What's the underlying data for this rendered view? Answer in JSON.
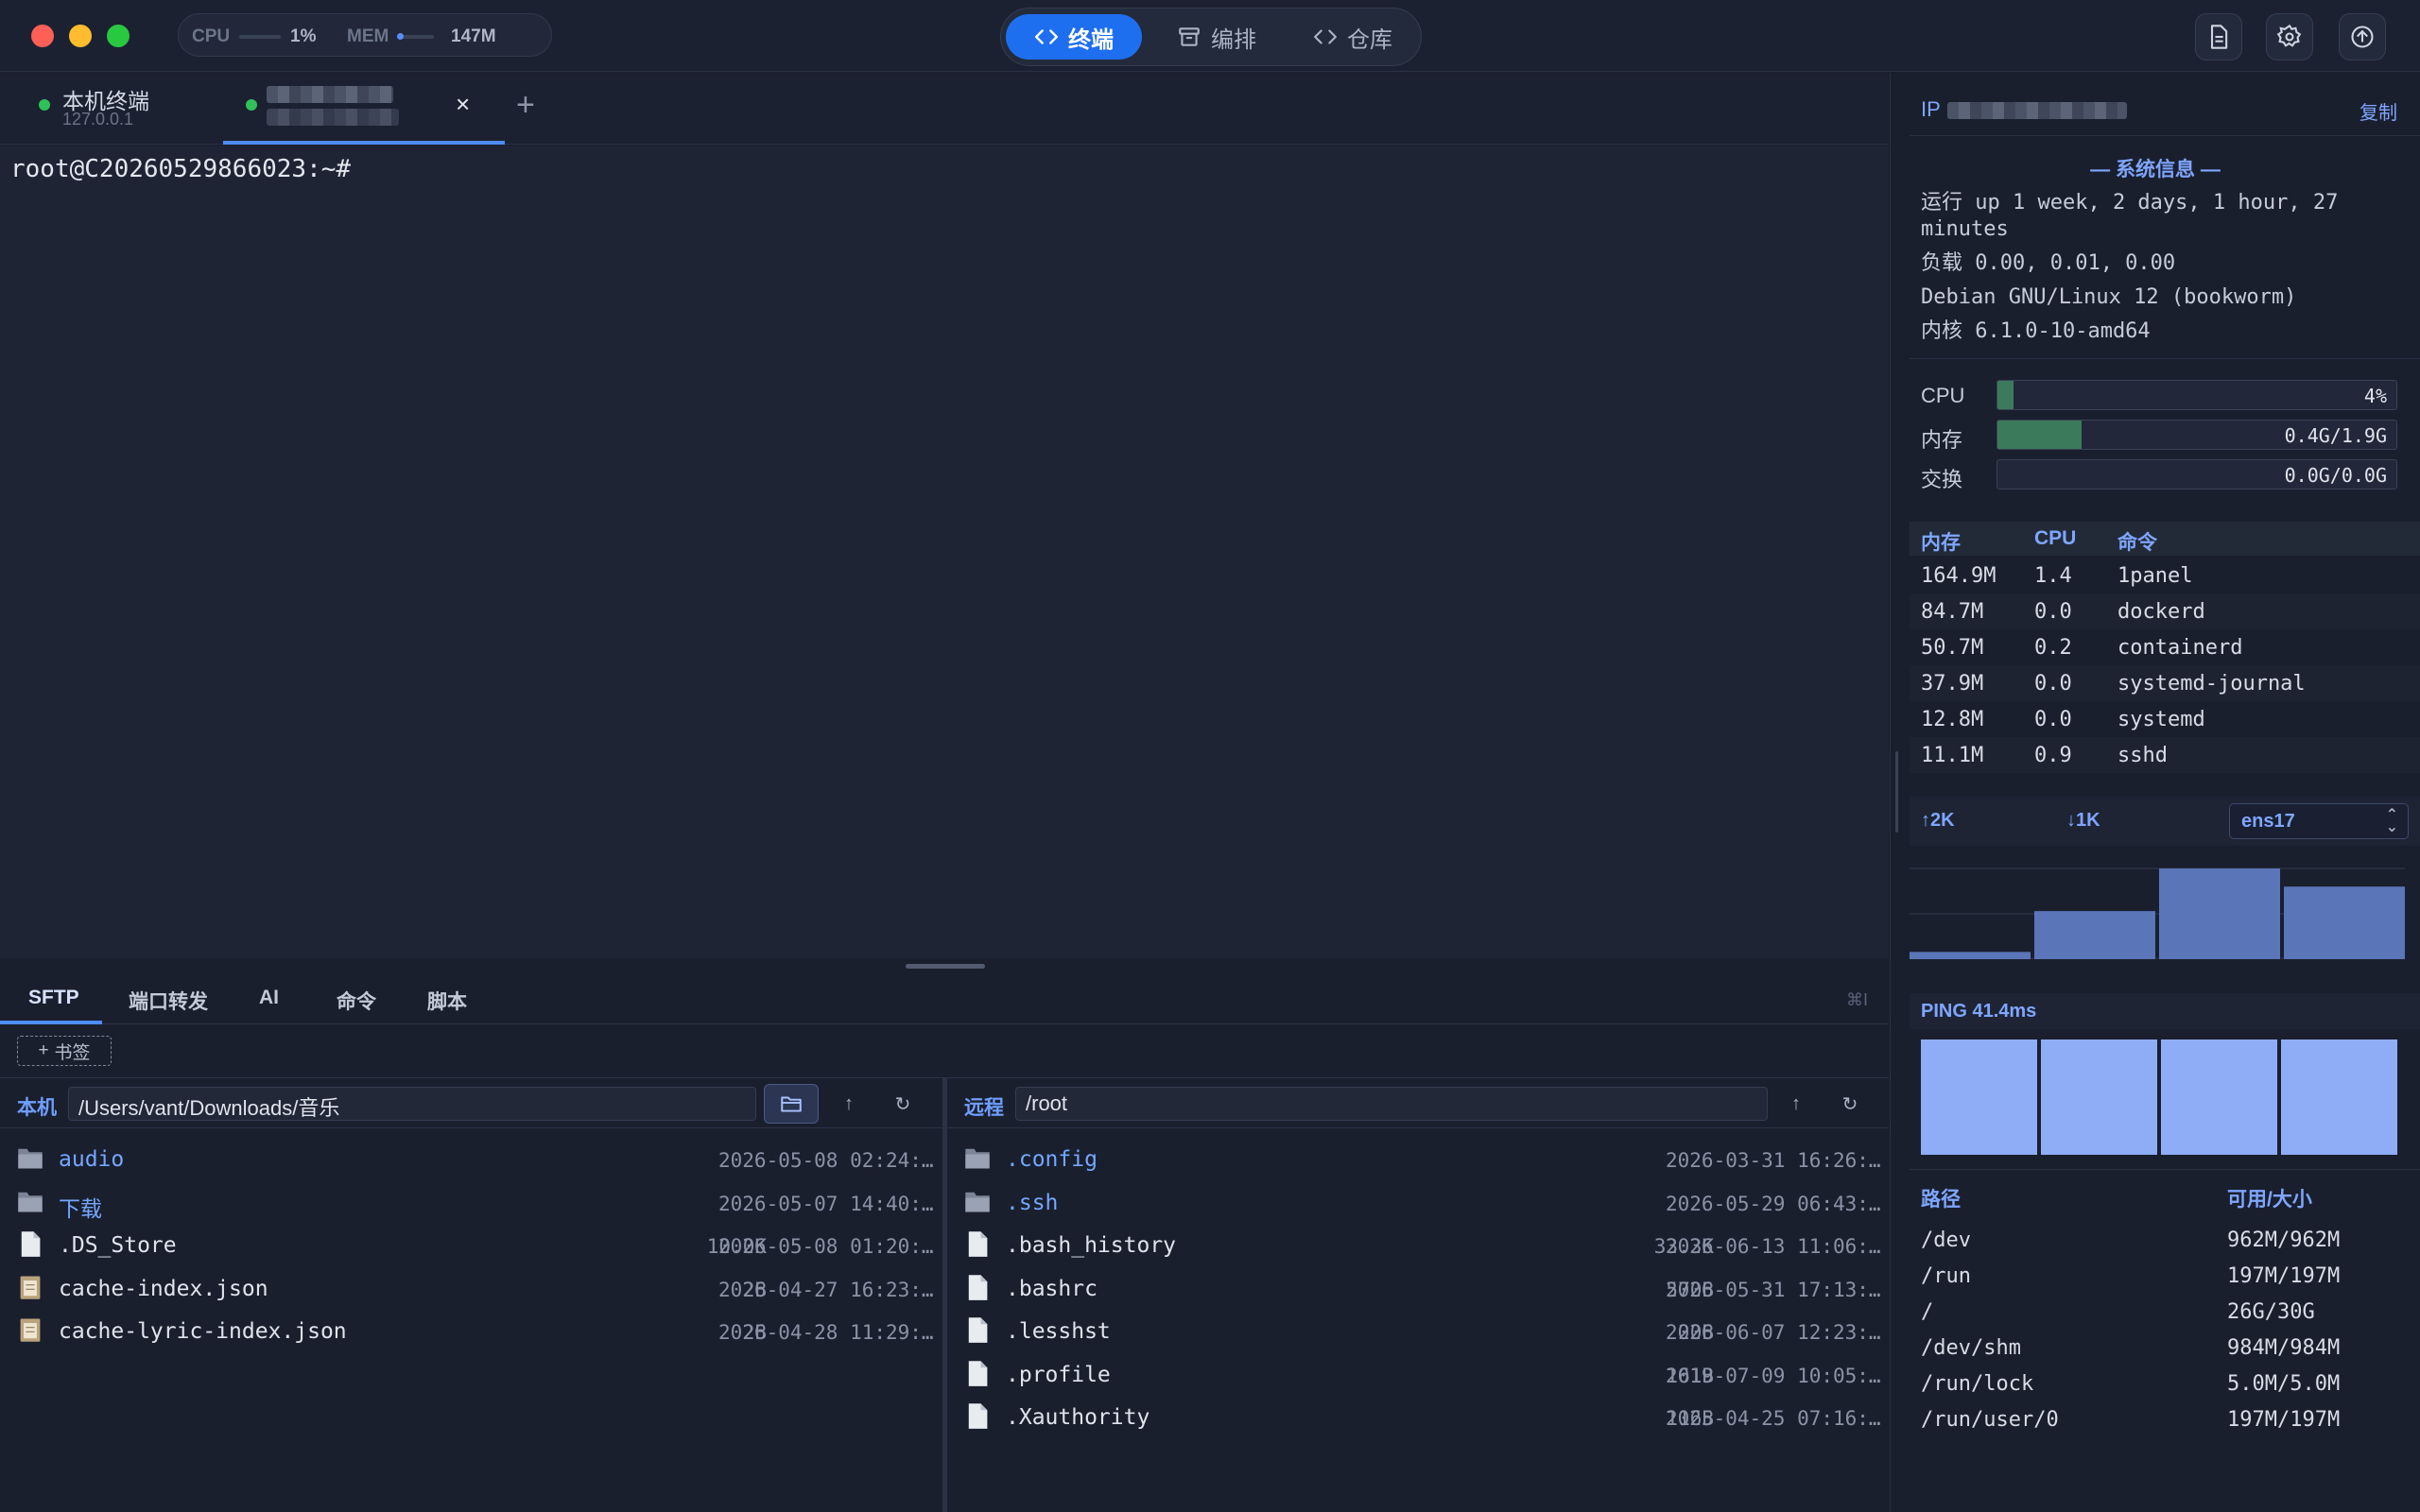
{
  "titlebar": {
    "cpu_label": "CPU",
    "cpu_value": "1%",
    "mem_label": "MEM",
    "mem_value": "147M",
    "modes": [
      {
        "label": "终端",
        "icon": "code-icon",
        "active": true
      },
      {
        "label": "编排",
        "icon": "archive-icon",
        "active": false
      },
      {
        "label": "仓库",
        "icon": "code-icon",
        "active": false
      }
    ],
    "actions": [
      "document-icon",
      "gear-icon",
      "upload-icon"
    ]
  },
  "tabs": [
    {
      "name": "本机终端",
      "host": "127.0.0.1",
      "status": "connected"
    },
    {
      "name": "",
      "host": "",
      "status": "connected",
      "redacted": true
    }
  ],
  "terminal": {
    "prompt": "root@C20260529866023:~#"
  },
  "bottom": {
    "tabs": [
      "SFTP",
      "端口转发",
      "AI",
      "命令",
      "脚本"
    ],
    "shortcut": "⌘I",
    "bookmark_label": "书签",
    "local": {
      "label": "本机",
      "path": "/Users/vant/Downloads/音乐",
      "files": [
        {
          "name": "audio",
          "type": "dir",
          "size": "",
          "date": "2026-05-08 02:24:…"
        },
        {
          "name": "下载",
          "type": "dir",
          "size": "",
          "date": "2026-05-07 14:40:…"
        },
        {
          "name": ".DS_Store",
          "type": "file",
          "size": "10.0K",
          "date": "2026-05-08 01:20:…"
        },
        {
          "name": "cache-index.json",
          "type": "json",
          "size": "2B",
          "date": "2026-04-27 16:23:…"
        },
        {
          "name": "cache-lyric-index.json",
          "type": "json",
          "size": "2B",
          "date": "2026-04-28 11:29:…"
        }
      ]
    },
    "remote": {
      "label": "远程",
      "path": "/root",
      "files": [
        {
          "name": ".config",
          "type": "dir",
          "size": "",
          "date": "2026-03-31 16:26:…"
        },
        {
          "name": ".ssh",
          "type": "dir",
          "size": "",
          "date": "2026-05-29 06:43:…"
        },
        {
          "name": ".bash_history",
          "type": "file",
          "size": "33.3K",
          "date": "2026-06-13 11:06:…"
        },
        {
          "name": ".bashrc",
          "type": "file",
          "size": "570B",
          "date": "2026-05-31 17:13:…"
        },
        {
          "name": ".lesshst",
          "type": "file",
          "size": "20B",
          "date": "2026-06-07 12:23:…"
        },
        {
          "name": ".profile",
          "type": "file",
          "size": "161B",
          "date": "2019-07-09 10:05:…"
        },
        {
          "name": ".Xauthority",
          "type": "file",
          "size": "116B",
          "date": "2025-04-25 07:16:…"
        }
      ]
    }
  },
  "side": {
    "ip_label": "IP",
    "copy_label": "复制",
    "sysinfo_title": "— 系统信息 —",
    "uptime": "运行 up 1 week, 2 days, 1 hour, 27 minutes",
    "load": "负载 0.00, 0.01, 0.00",
    "os": "Debian GNU/Linux 12 (bookworm)",
    "kernel": "内核 6.1.0-10-amd64",
    "meters": [
      {
        "label": "CPU",
        "value": "4%",
        "fraction": 0.04
      },
      {
        "label": "内存",
        "value": "0.4G/1.9G",
        "fraction": 0.21
      },
      {
        "label": "交换",
        "value": "0.0G/0.0G",
        "fraction": 0
      }
    ],
    "process_headers": [
      "内存",
      "CPU",
      "命令"
    ],
    "processes": [
      {
        "mem": "164.9M",
        "cpu": "1.4",
        "cmd": "1panel"
      },
      {
        "mem": "84.7M",
        "cpu": "0.0",
        "cmd": "dockerd"
      },
      {
        "mem": "50.7M",
        "cpu": "0.2",
        "cmd": "containerd"
      },
      {
        "mem": "37.9M",
        "cpu": "0.0",
        "cmd": "systemd-journal"
      },
      {
        "mem": "12.8M",
        "cpu": "0.0",
        "cmd": "systemd"
      },
      {
        "mem": "11.1M",
        "cpu": "0.9",
        "cmd": "sshd"
      }
    ],
    "net": {
      "up": "↑2K",
      "down": "↓1K",
      "interface": "ens17",
      "bars": [
        0.08,
        0.53,
        1.0,
        0.8
      ]
    },
    "ping": {
      "label": "PING 41.4ms",
      "bars": [
        1,
        1,
        1,
        1
      ]
    },
    "disk_headers": [
      "路径",
      "可用/大小"
    ],
    "disks": [
      {
        "path": "/dev",
        "usage": "962M/962M"
      },
      {
        "path": "/run",
        "usage": "197M/197M"
      },
      {
        "path": "/",
        "usage": "26G/30G"
      },
      {
        "path": "/dev/shm",
        "usage": "984M/984M"
      },
      {
        "path": "/run/lock",
        "usage": "5.0M/5.0M"
      },
      {
        "path": "/run/user/0",
        "usage": "197M/197M"
      }
    ]
  },
  "colors": {
    "accent": "#1e6ef0",
    "link": "#7fa6ff",
    "meter_fill": "#3c7a5c",
    "net_bar": "#5a75b8",
    "ping_bar": "#8fadf7"
  }
}
